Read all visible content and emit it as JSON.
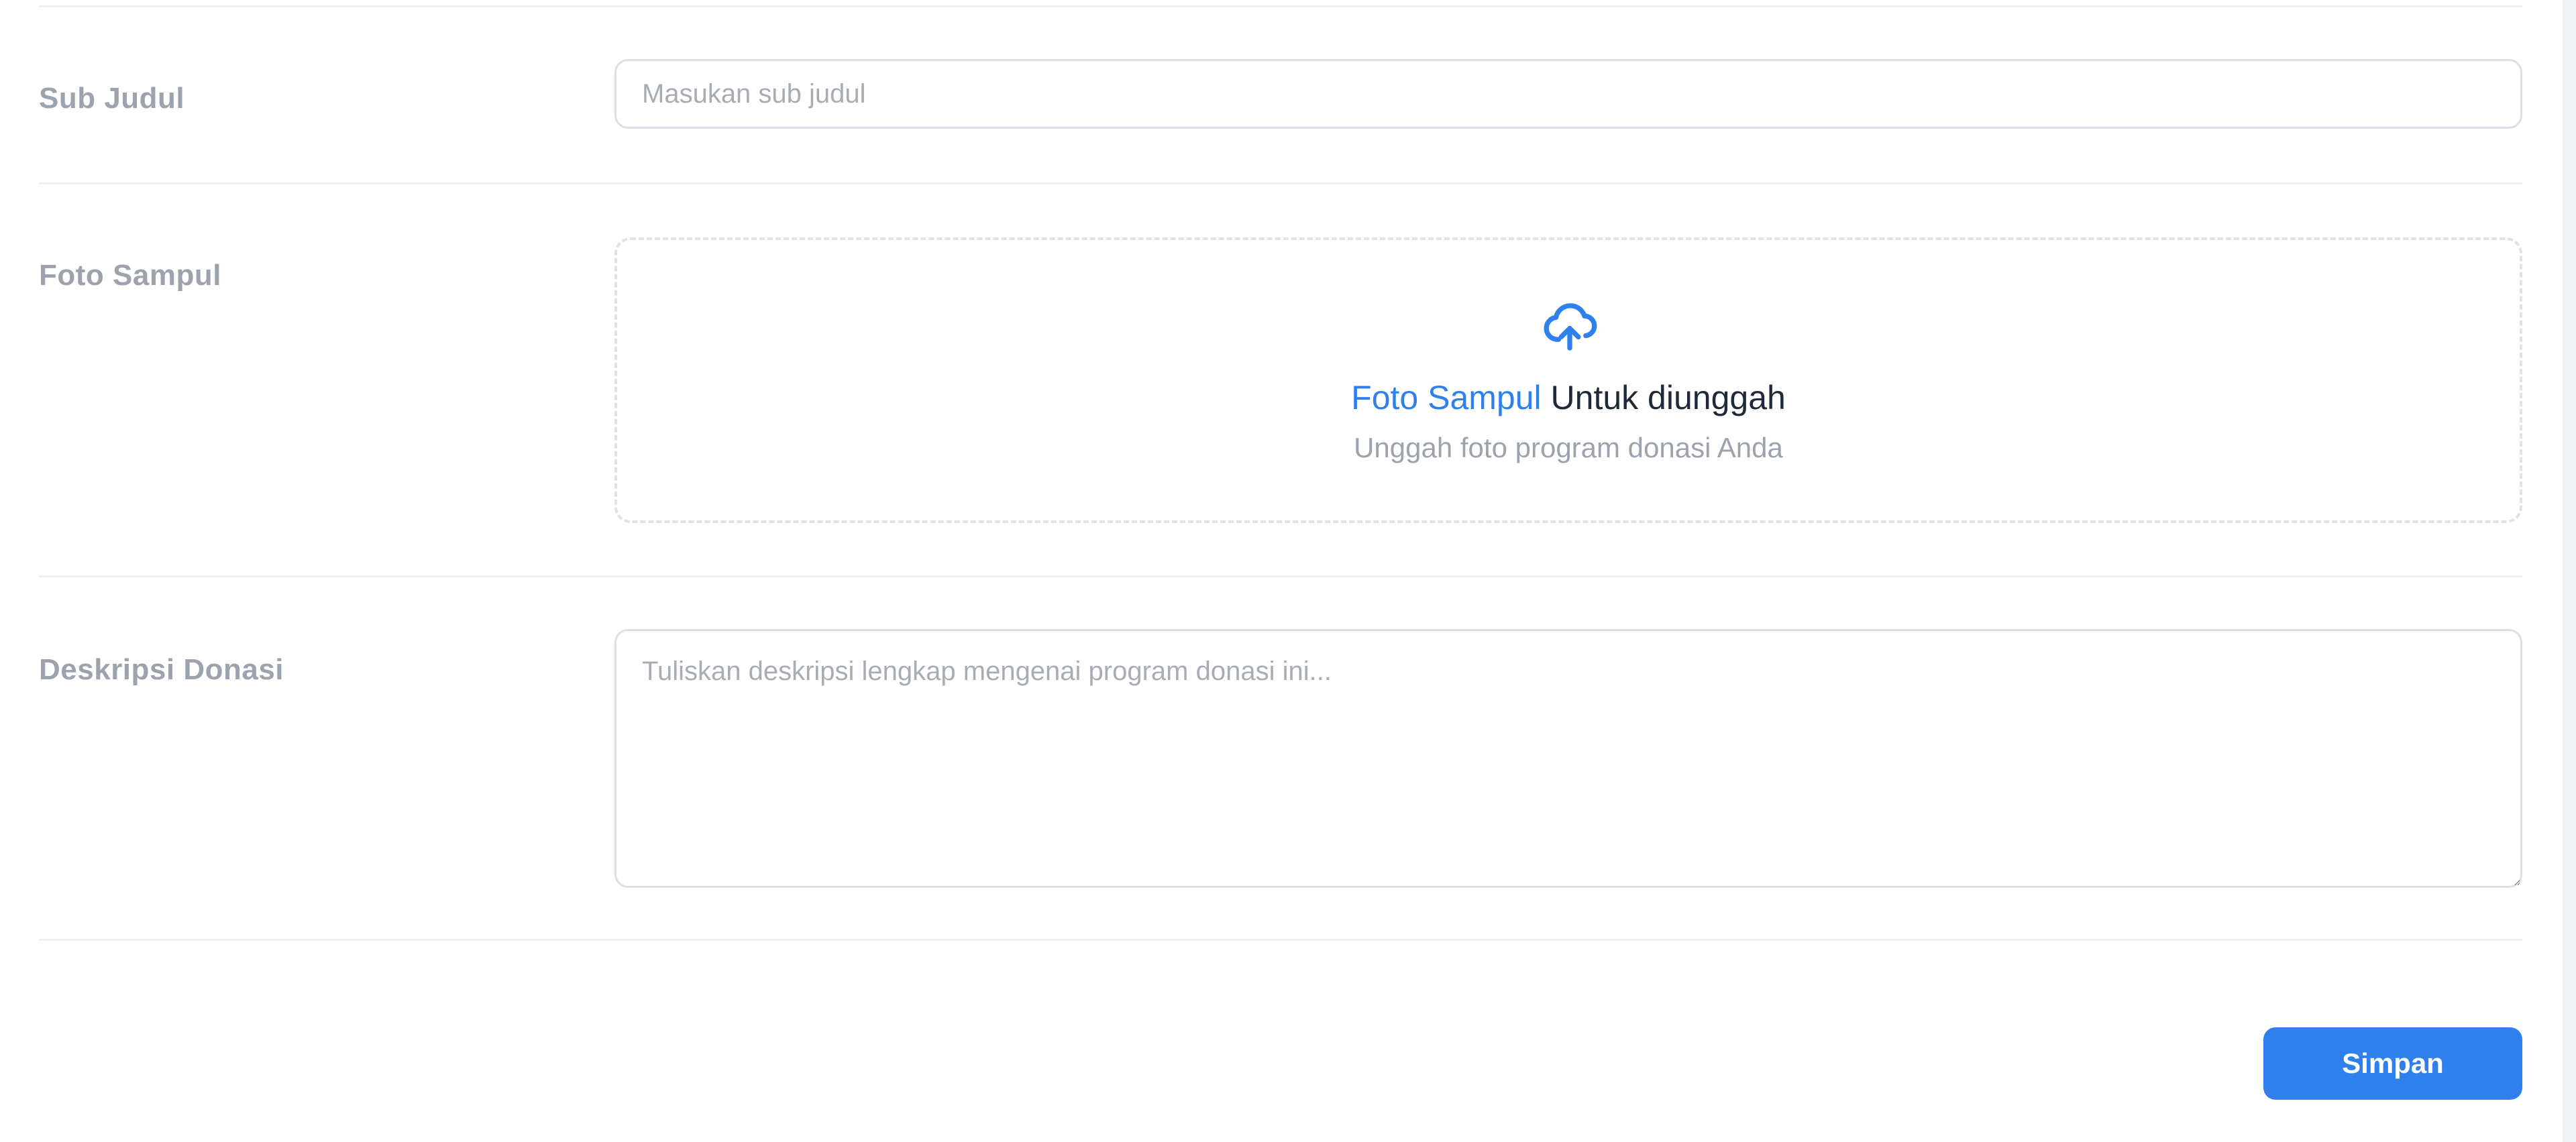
{
  "form": {
    "sub_judul": {
      "label": "Sub Judul",
      "value": "",
      "placeholder": "Masukan sub judul"
    },
    "foto_sampul": {
      "label": "Foto Sampul",
      "upload_link": "Foto Sampul",
      "upload_text": " Untuk diunggah",
      "upload_hint": "Unggah foto program donasi Anda",
      "icon": "cloud-upload-icon"
    },
    "deskripsi": {
      "label": "Deskripsi Donasi",
      "value": "",
      "placeholder": "Tuliskan deskripsi lengkap mengenai program donasi ini..."
    },
    "save_label": "Simpan"
  },
  "colors": {
    "accent": "#2f80ed",
    "label": "#9ca3af",
    "border": "#dcdfe4",
    "divider": "#eef0f3"
  }
}
